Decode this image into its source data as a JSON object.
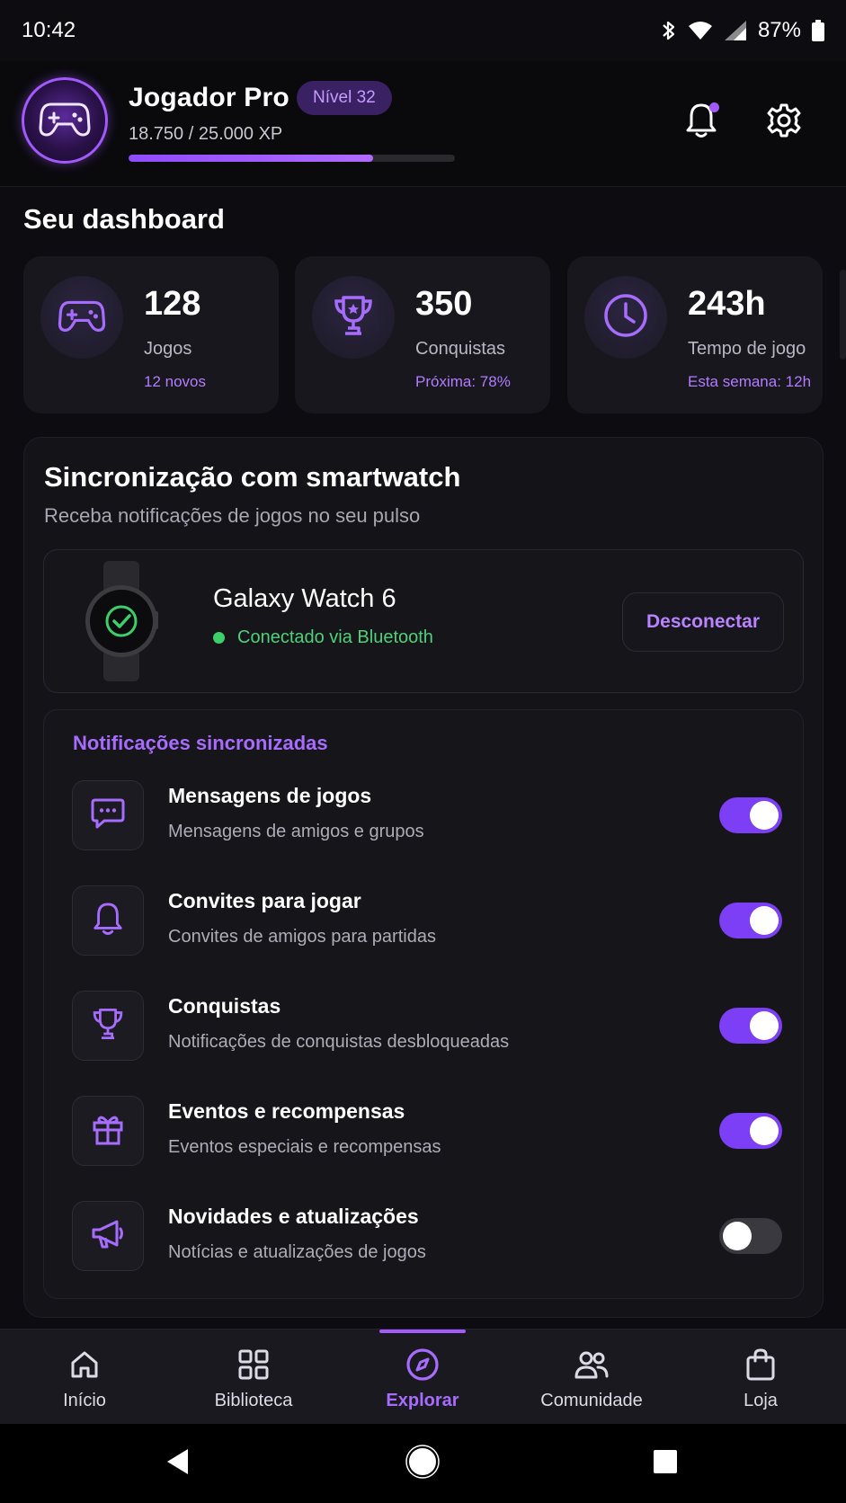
{
  "status_bar": {
    "time": "10:42",
    "battery": "87%"
  },
  "profile": {
    "name": "Jogador Pro",
    "level": "Nível 32",
    "xp_text": "18.750 / 25.000 XP",
    "xp_progress": 0.75
  },
  "dashboard": {
    "title": "Seu dashboard",
    "stats": [
      {
        "value": "128",
        "label": "Jogos",
        "sub": "12 novos",
        "icon": "gamepad-icon"
      },
      {
        "value": "350",
        "label": "Conquistas",
        "sub": "Próxima: 78%",
        "icon": "trophy-icon"
      },
      {
        "value": "243h",
        "label": "Tempo de jogo",
        "sub": "Esta semana: 12h",
        "icon": "clock-icon"
      }
    ]
  },
  "sync": {
    "title": "Sincronização com smartwatch",
    "subtitle": "Receba notificações de jogos no seu pulso",
    "device_name": "Galaxy Watch 6",
    "device_status": "Conectado via Bluetooth",
    "disconnect_label": "Desconectar",
    "notifications_heading": "Notificações sincronizadas",
    "notifications": [
      {
        "title": "Mensagens de jogos",
        "desc": "Mensagens de amigos e grupos",
        "enabled": true,
        "icon": "chat-icon"
      },
      {
        "title": "Convites para jogar",
        "desc": "Convites de amigos para partidas",
        "enabled": true,
        "icon": "bell-icon"
      },
      {
        "title": "Conquistas",
        "desc": "Notificações de conquistas desbloqueadas",
        "enabled": true,
        "icon": "trophy-icon"
      },
      {
        "title": "Eventos e recompensas",
        "desc": "Eventos especiais e recompensas",
        "enabled": true,
        "icon": "gift-icon"
      },
      {
        "title": "Novidades e atualizações",
        "desc": "Notícias e atualizações de jogos",
        "enabled": false,
        "icon": "megaphone-icon"
      }
    ]
  },
  "bottom_nav": [
    {
      "label": "Início",
      "icon": "home-icon",
      "active": false
    },
    {
      "label": "Biblioteca",
      "icon": "grid-icon",
      "active": false
    },
    {
      "label": "Explorar",
      "icon": "compass-icon",
      "active": true
    },
    {
      "label": "Comunidade",
      "icon": "people-icon",
      "active": false
    },
    {
      "label": "Loja",
      "icon": "bag-icon",
      "active": false
    }
  ],
  "colors": {
    "accent": "#a259ff",
    "background": "#0d0c10",
    "card": "#18171d",
    "connected": "#3ccf6a"
  }
}
